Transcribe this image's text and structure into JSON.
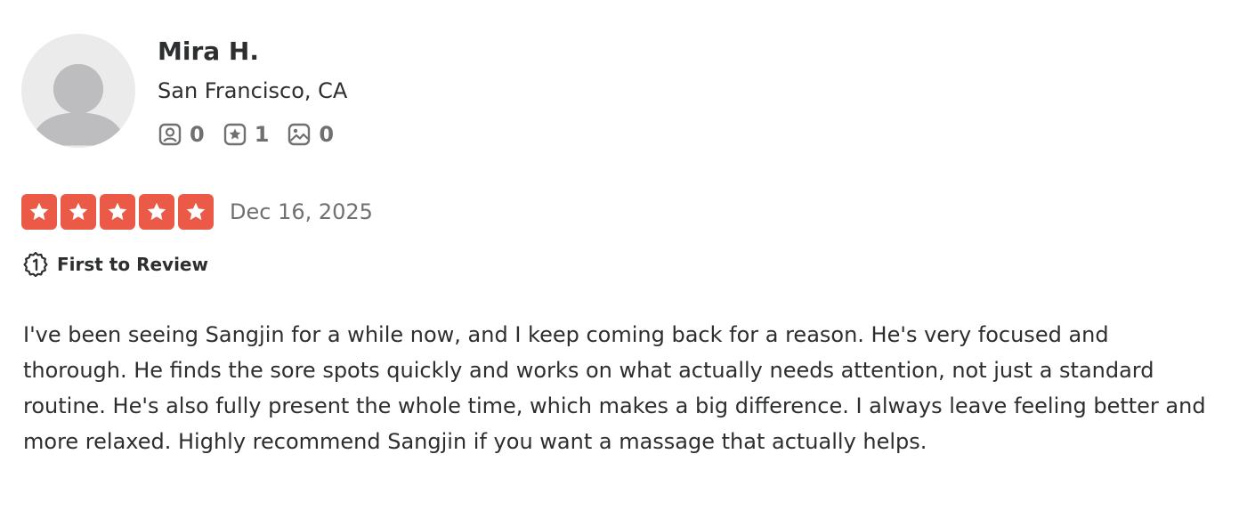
{
  "user": {
    "name": "Mira H.",
    "location": "San Francisco, CA",
    "stats": [
      {
        "icon": "friends-icon",
        "count": "0"
      },
      {
        "icon": "reviews-star-icon",
        "count": "1"
      },
      {
        "icon": "photos-icon",
        "count": "0"
      }
    ]
  },
  "review": {
    "rating": 5,
    "max_rating": 5,
    "date": "Dec 16, 2025",
    "badge": {
      "icon": "first-to-review-icon",
      "label": "First to Review"
    },
    "text": "I've been seeing Sangjin for a while now, and I keep coming back for a reason. He's very focused and thorough. He finds the sore spots quickly and works on what actually needs attention, not just a standard routine. He's also fully present the whole time, which makes a big difference. I always leave feeling better and more relaxed. Highly recommend Sangjin if you want a massage that actually helps."
  },
  "colors": {
    "star_background": "#eb5a46",
    "text": "#2d2e2f",
    "muted": "#6e7072",
    "avatar_bg": "#ebebeb",
    "avatar_figure": "#bdbdbf"
  }
}
